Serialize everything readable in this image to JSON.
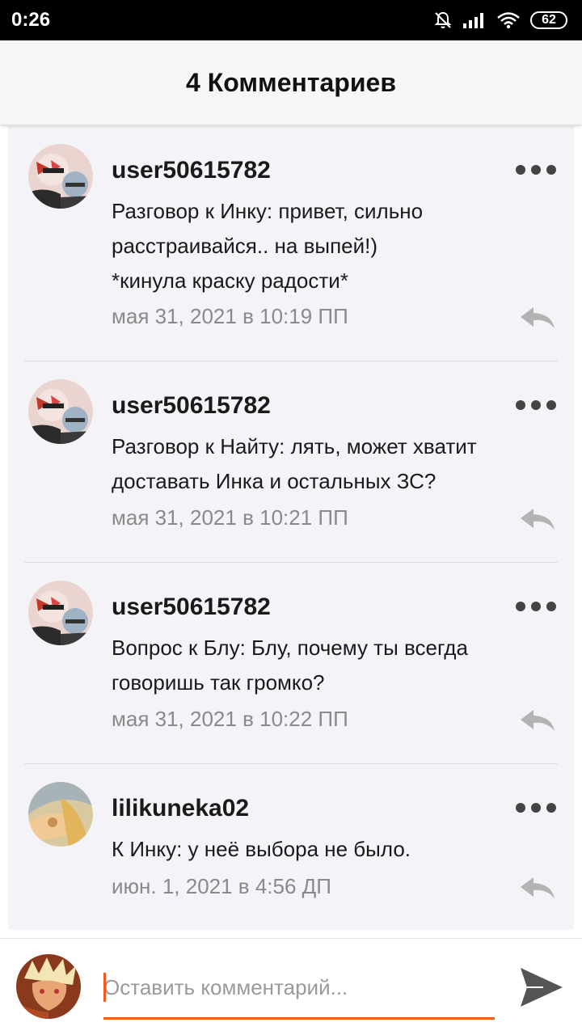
{
  "status_bar": {
    "time": "0:26",
    "battery": "62",
    "icons": [
      "mute-bell-icon",
      "signal-icon",
      "wifi-icon",
      "battery-icon"
    ]
  },
  "header": {
    "title": "4 Комментариев"
  },
  "comments": [
    {
      "username": "user50615782",
      "text": "Разговор к Инку: привет, сильно расстраивайся.. на выпей!) *кинула краску радости*",
      "date": "мая 31, 2021 в 10:19 ПП",
      "avatar": "avatar-anime-red"
    },
    {
      "username": "user50615782",
      "text": "Разговор к Найту: лять, может хватит доставать Инка и остальных ЗС?",
      "date": "мая 31, 2021 в 10:21 ПП",
      "avatar": "avatar-anime-red"
    },
    {
      "username": "user50615782",
      "text": "Вопрос к Блу: Блу, почему ты всегда говоришь так громко?",
      "date": "мая 31, 2021 в 10:22 ПП",
      "avatar": "avatar-anime-red"
    },
    {
      "username": "lilikuneka02",
      "text": "К Инку: у неё выбора не было.",
      "date": "июн. 1, 2021 в 4:56 ДП",
      "avatar": "avatar-anime-gold"
    }
  ],
  "composer": {
    "placeholder": "Оставить комментарий..."
  },
  "colors": {
    "accent": "#f25a1e",
    "comments_bg": "#f4f3f8",
    "header_bg": "#f6f6f6"
  }
}
